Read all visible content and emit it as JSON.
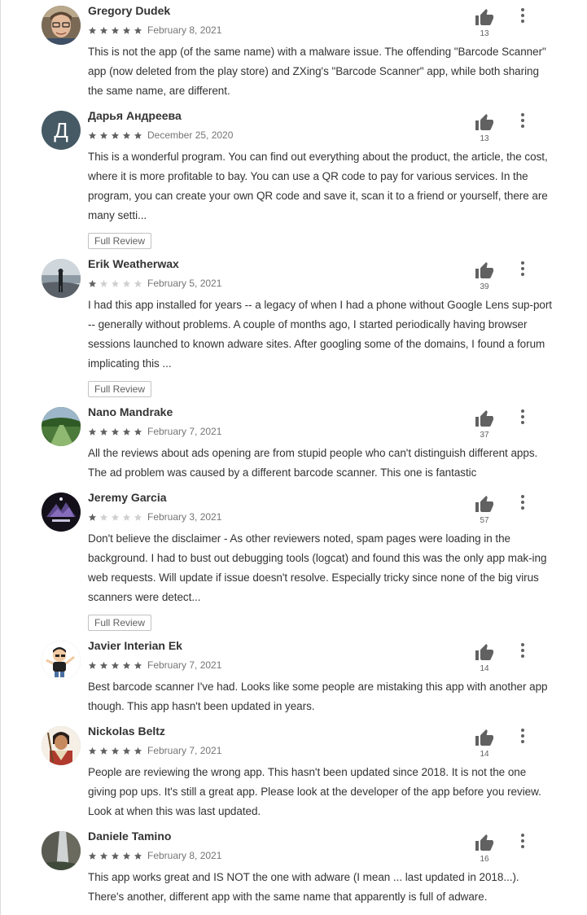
{
  "colors": {
    "star_filled": "#616161",
    "star_empty": "#d0d0d0",
    "thumb": "#616161"
  },
  "icons": {
    "thumb": "thumb-up-icon",
    "menu": "more-vert-icon",
    "star": "star-icon"
  },
  "reviews": [
    {
      "author": "Gregory Dudek",
      "rating": 5,
      "date": "February 8, 2021",
      "helpful": "13",
      "text": "This is not the app (of the same name) with a malware issue. The offending \"Barcode Scanner\" app (now deleted from the play store) and ZXing's \"Barcode Scanner\" app, while both sharing the same name, are different."
    },
    {
      "author": "Дарья Андреева",
      "rating": 5,
      "date": "December 25, 2020",
      "helpful": "13",
      "avatar_letter": "Д",
      "text": "This is a wonderful program. You can find out everything about the product, the article, the cost, where it is more profitable to bay. You can use a QR code to pay for various services. In the program, you can create your own QR code and save it, scan it to a friend or yourself, there are many setti...",
      "full_review": "Full Review"
    },
    {
      "author": "Erik Weatherwax",
      "rating": 1,
      "date": "February 5, 2021",
      "helpful": "39",
      "text": "I had this app installed for years -- a legacy of when I had a phone without Google Lens sup-port -- generally without problems. A couple of months ago, I started periodically having browser sessions launched to known adware sites. After googling some of the domains, I found a forum implicating this ...",
      "full_review": "Full Review"
    },
    {
      "author": "Nano Mandrake",
      "rating": 5,
      "date": "February 7, 2021",
      "helpful": "37",
      "text": "All the reviews about ads opening are from stupid people who can't distinguish different apps. The ad problem was caused by a different barcode scanner. This one is fantastic"
    },
    {
      "author": "Jeremy Garcia",
      "rating": 1,
      "date": "February 3, 2021",
      "helpful": "57",
      "text": "Don't believe the disclaimer - As other reviewers noted, spam pages were loading in the background. I had to bust out debugging tools (logcat) and found this was the only app mak-ing web requests. Will update if issue doesn't resolve. Especially tricky since none of the big virus scanners were detect...",
      "full_review": "Full Review"
    },
    {
      "author": "Javier Interian Ek",
      "rating": 5,
      "date": "February 7, 2021",
      "helpful": "14",
      "text": "Best barcode scanner I've had. Looks like some people are mistaking this app with another app though. This app hasn't been updated in years."
    },
    {
      "author": "Nickolas Beltz",
      "rating": 5,
      "date": "February 7, 2021",
      "helpful": "14",
      "text": "People are reviewing the wrong app. This hasn't been updated since 2018. It is not the one giving pop ups. It's still a great app. Please look at the developer of the app before you review. Look at when this was last updated."
    },
    {
      "author": "Daniele Tamino",
      "rating": 5,
      "date": "February 8, 2021",
      "helpful": "16",
      "text": "This app works great and IS NOT the one with adware (I mean ... last updated in 2018...). There's another, different app with the same name that apparently is full of adware."
    }
  ]
}
